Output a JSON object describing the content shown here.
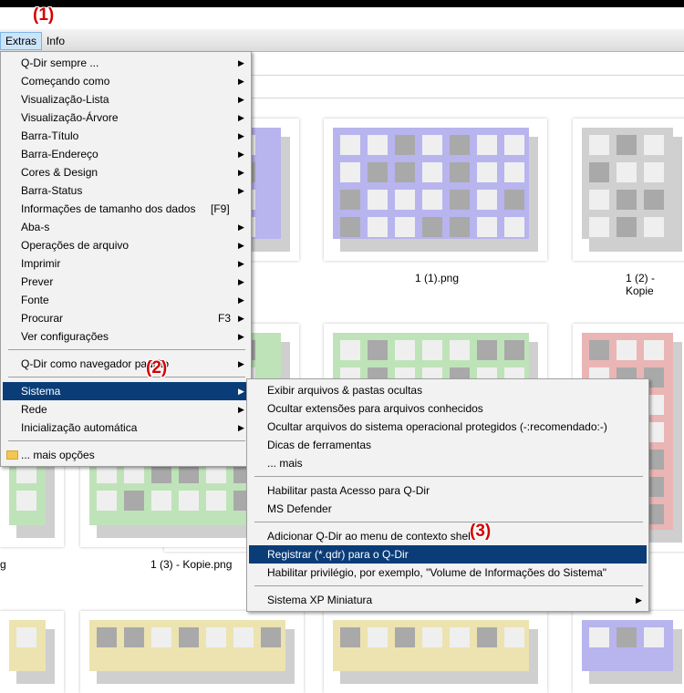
{
  "menubar": {
    "extras": "Extras",
    "info": "Info"
  },
  "callouts": {
    "c1": "(1)",
    "c2": "(2)",
    "c3": "(3)"
  },
  "captions": {
    "cap1": "1 (1).png",
    "cap2": "1 (2) - Kopie",
    "cap3": "1 (3) - Kopie.png",
    "cap4": "g"
  },
  "extras_menu": [
    {
      "label": "Q-Dir sempre ...",
      "submenu": true
    },
    {
      "label": "Começando como",
      "submenu": true
    },
    {
      "label": "Visualização-Lista",
      "submenu": true
    },
    {
      "label": "Visualização-Árvore",
      "submenu": true
    },
    {
      "label": "Barra-Título",
      "submenu": true
    },
    {
      "label": "Barra-Endereço",
      "submenu": true
    },
    {
      "label": "Cores & Design",
      "submenu": true
    },
    {
      "label": "Barra-Status",
      "submenu": true
    },
    {
      "label": "Informações de tamanho dos dados",
      "shortcut": "[F9]"
    },
    {
      "label": "Aba-s",
      "submenu": true
    },
    {
      "label": "Operações de arquivo",
      "submenu": true
    },
    {
      "label": "Imprimir",
      "submenu": true
    },
    {
      "label": "Prever",
      "submenu": true
    },
    {
      "label": "Fonte",
      "submenu": true
    },
    {
      "label": "Procurar",
      "shortcut": "F3",
      "submenu": true
    },
    {
      "label": "Ver configurações",
      "submenu": true
    },
    {
      "separator": true
    },
    {
      "label": "Q-Dir como navegador padrão",
      "submenu": true
    },
    {
      "separator": true
    },
    {
      "label": "Sistema",
      "submenu": true,
      "selected": true
    },
    {
      "label": "Rede",
      "submenu": true
    },
    {
      "label": "Inicialização automática",
      "submenu": true
    },
    {
      "separator": true
    },
    {
      "label": "... mais opções",
      "icon": "folder-icon"
    }
  ],
  "system_submenu": [
    {
      "label": "Exibir arquivos & pastas ocultas"
    },
    {
      "label": "Ocultar extensões para arquivos conhecidos"
    },
    {
      "label": "Ocultar arquivos do sistema operacional protegidos (-:recomendado:-)"
    },
    {
      "label": "Dicas de ferramentas"
    },
    {
      "label": "... mais"
    },
    {
      "separator": true
    },
    {
      "label": "Habilitar pasta Acesso para Q-Dir"
    },
    {
      "label": "MS Defender"
    },
    {
      "separator": true
    },
    {
      "label": "Adicionar Q-Dir ao menu de contexto shell"
    },
    {
      "label": "Registrar (*.qdr) para o Q-Dir",
      "selected": true
    },
    {
      "label": "Habilitar privilégio, por exemplo, \"Volume de Informações do Sistema\""
    },
    {
      "separator": true
    },
    {
      "label": "Sistema XP Miniatura",
      "submenu": true
    }
  ],
  "arrow_glyph": "▶",
  "colors": {
    "menu_bg": "#f2f2f2",
    "selected_bg": "#0a3c78",
    "callout": "#d40000",
    "purple": "#b8b4ee",
    "gray": "#d0d0d0",
    "green": "#bfe3b8",
    "pink": "#eab5b5",
    "yellow": "#ece3b0"
  }
}
